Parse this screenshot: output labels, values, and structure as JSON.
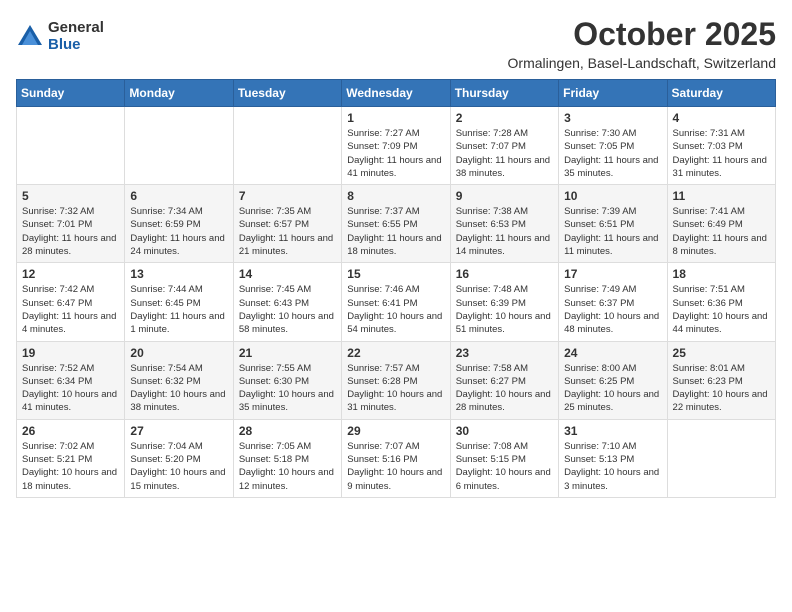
{
  "header": {
    "logo_general": "General",
    "logo_blue": "Blue",
    "month_title": "October 2025",
    "location": "Ormalingen, Basel-Landschaft, Switzerland"
  },
  "weekdays": [
    "Sunday",
    "Monday",
    "Tuesday",
    "Wednesday",
    "Thursday",
    "Friday",
    "Saturday"
  ],
  "weeks": [
    [
      {
        "day": "",
        "info": ""
      },
      {
        "day": "",
        "info": ""
      },
      {
        "day": "",
        "info": ""
      },
      {
        "day": "1",
        "info": "Sunrise: 7:27 AM\nSunset: 7:09 PM\nDaylight: 11 hours and 41 minutes."
      },
      {
        "day": "2",
        "info": "Sunrise: 7:28 AM\nSunset: 7:07 PM\nDaylight: 11 hours and 38 minutes."
      },
      {
        "day": "3",
        "info": "Sunrise: 7:30 AM\nSunset: 7:05 PM\nDaylight: 11 hours and 35 minutes."
      },
      {
        "day": "4",
        "info": "Sunrise: 7:31 AM\nSunset: 7:03 PM\nDaylight: 11 hours and 31 minutes."
      }
    ],
    [
      {
        "day": "5",
        "info": "Sunrise: 7:32 AM\nSunset: 7:01 PM\nDaylight: 11 hours and 28 minutes."
      },
      {
        "day": "6",
        "info": "Sunrise: 7:34 AM\nSunset: 6:59 PM\nDaylight: 11 hours and 24 minutes."
      },
      {
        "day": "7",
        "info": "Sunrise: 7:35 AM\nSunset: 6:57 PM\nDaylight: 11 hours and 21 minutes."
      },
      {
        "day": "8",
        "info": "Sunrise: 7:37 AM\nSunset: 6:55 PM\nDaylight: 11 hours and 18 minutes."
      },
      {
        "day": "9",
        "info": "Sunrise: 7:38 AM\nSunset: 6:53 PM\nDaylight: 11 hours and 14 minutes."
      },
      {
        "day": "10",
        "info": "Sunrise: 7:39 AM\nSunset: 6:51 PM\nDaylight: 11 hours and 11 minutes."
      },
      {
        "day": "11",
        "info": "Sunrise: 7:41 AM\nSunset: 6:49 PM\nDaylight: 11 hours and 8 minutes."
      }
    ],
    [
      {
        "day": "12",
        "info": "Sunrise: 7:42 AM\nSunset: 6:47 PM\nDaylight: 11 hours and 4 minutes."
      },
      {
        "day": "13",
        "info": "Sunrise: 7:44 AM\nSunset: 6:45 PM\nDaylight: 11 hours and 1 minute."
      },
      {
        "day": "14",
        "info": "Sunrise: 7:45 AM\nSunset: 6:43 PM\nDaylight: 10 hours and 58 minutes."
      },
      {
        "day": "15",
        "info": "Sunrise: 7:46 AM\nSunset: 6:41 PM\nDaylight: 10 hours and 54 minutes."
      },
      {
        "day": "16",
        "info": "Sunrise: 7:48 AM\nSunset: 6:39 PM\nDaylight: 10 hours and 51 minutes."
      },
      {
        "day": "17",
        "info": "Sunrise: 7:49 AM\nSunset: 6:37 PM\nDaylight: 10 hours and 48 minutes."
      },
      {
        "day": "18",
        "info": "Sunrise: 7:51 AM\nSunset: 6:36 PM\nDaylight: 10 hours and 44 minutes."
      }
    ],
    [
      {
        "day": "19",
        "info": "Sunrise: 7:52 AM\nSunset: 6:34 PM\nDaylight: 10 hours and 41 minutes."
      },
      {
        "day": "20",
        "info": "Sunrise: 7:54 AM\nSunset: 6:32 PM\nDaylight: 10 hours and 38 minutes."
      },
      {
        "day": "21",
        "info": "Sunrise: 7:55 AM\nSunset: 6:30 PM\nDaylight: 10 hours and 35 minutes."
      },
      {
        "day": "22",
        "info": "Sunrise: 7:57 AM\nSunset: 6:28 PM\nDaylight: 10 hours and 31 minutes."
      },
      {
        "day": "23",
        "info": "Sunrise: 7:58 AM\nSunset: 6:27 PM\nDaylight: 10 hours and 28 minutes."
      },
      {
        "day": "24",
        "info": "Sunrise: 8:00 AM\nSunset: 6:25 PM\nDaylight: 10 hours and 25 minutes."
      },
      {
        "day": "25",
        "info": "Sunrise: 8:01 AM\nSunset: 6:23 PM\nDaylight: 10 hours and 22 minutes."
      }
    ],
    [
      {
        "day": "26",
        "info": "Sunrise: 7:02 AM\nSunset: 5:21 PM\nDaylight: 10 hours and 18 minutes."
      },
      {
        "day": "27",
        "info": "Sunrise: 7:04 AM\nSunset: 5:20 PM\nDaylight: 10 hours and 15 minutes."
      },
      {
        "day": "28",
        "info": "Sunrise: 7:05 AM\nSunset: 5:18 PM\nDaylight: 10 hours and 12 minutes."
      },
      {
        "day": "29",
        "info": "Sunrise: 7:07 AM\nSunset: 5:16 PM\nDaylight: 10 hours and 9 minutes."
      },
      {
        "day": "30",
        "info": "Sunrise: 7:08 AM\nSunset: 5:15 PM\nDaylight: 10 hours and 6 minutes."
      },
      {
        "day": "31",
        "info": "Sunrise: 7:10 AM\nSunset: 5:13 PM\nDaylight: 10 hours and 3 minutes."
      },
      {
        "day": "",
        "info": ""
      }
    ]
  ]
}
